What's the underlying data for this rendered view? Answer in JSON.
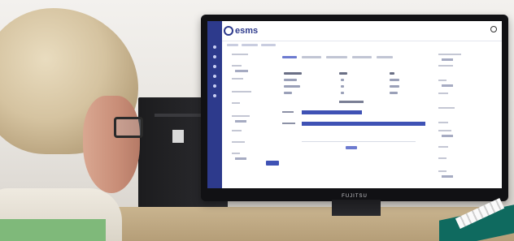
{
  "monitor": {
    "brand": "FUJITSU",
    "app": {
      "logo_text": "esms"
    }
  },
  "colors": {
    "accent": "#2d3a8c",
    "bar": "#3f52b5",
    "hair": "#d5c3a0",
    "sweater": "#7fb97a"
  },
  "icons": [
    "logo-icon",
    "user-icon"
  ]
}
